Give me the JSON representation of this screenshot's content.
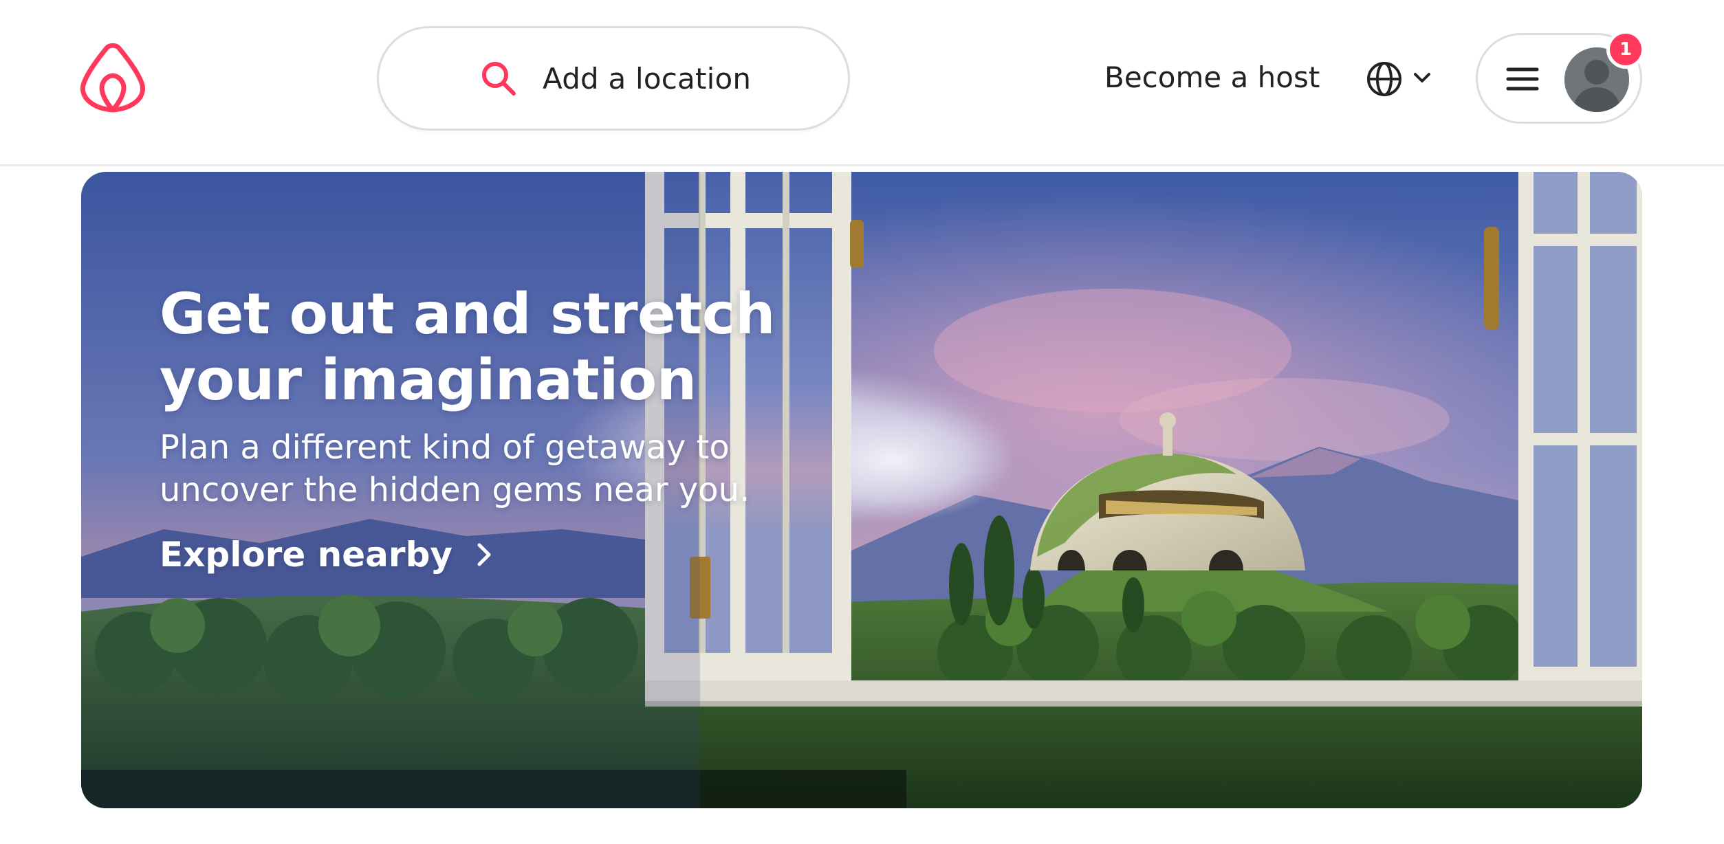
{
  "header": {
    "logo": "airbnb-logo",
    "search_label": "Add a location",
    "become_host_label": "Become a host",
    "notification_count": "1"
  },
  "hero": {
    "title": "Get out and stretch your imagination",
    "subtitle": "Plan a different kind of getaway to uncover the hidden gems near you.",
    "cta_label": "Explore nearby"
  },
  "icons": {
    "search": "search-icon",
    "globe": "globe-icon",
    "menu": "hamburger-menu-icon",
    "profile": "user-avatar",
    "cta": "chevron-right-icon"
  },
  "colors": {
    "brand": "#FF385C",
    "text": "#222222",
    "border": "#DDDDDD",
    "hero_text": "#FFFFFF"
  }
}
